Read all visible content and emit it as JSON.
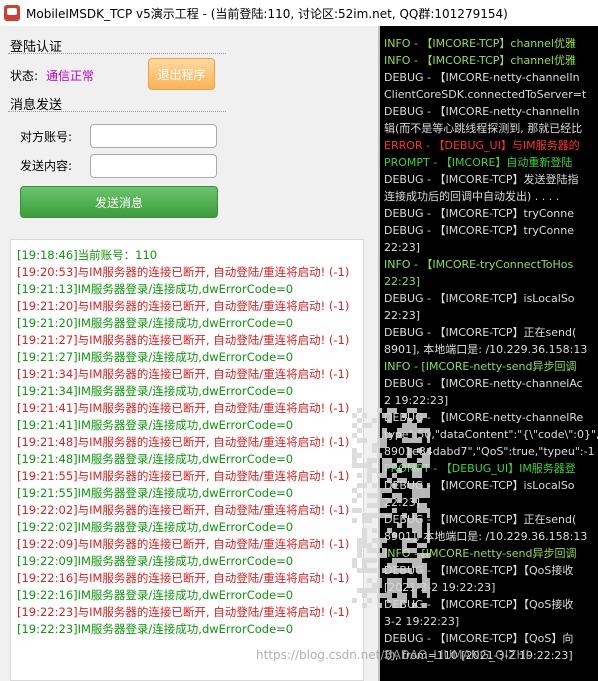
{
  "window": {
    "title": "MobileIMSDK_TCP v5演示工程 - (当前登陆:110, 讨论区:52im.net, QQ群:101279154)"
  },
  "login_section": {
    "title": "登陆认证",
    "status_label": "状态:",
    "status_value": "通信正常",
    "logout_button": "退出程序"
  },
  "message_section": {
    "title": "消息发送",
    "to_account_label": "对方账号:",
    "to_account_value": "",
    "content_label": "发送内容:",
    "content_value": "",
    "send_button": "发送消息"
  },
  "log": [
    {
      "text": "[19:18:46]当前账号：110",
      "level": "ok"
    },
    {
      "text": "[19:20:53]与IM服务器的连接已断开, 自动登陆/重连将启动! (-1)",
      "level": "error"
    },
    {
      "text": "[19:21:13]IM服务器登录/连接成功,dwErrorCode=0",
      "level": "ok"
    },
    {
      "text": "[19:21:20]与IM服务器的连接已断开, 自动登陆/重连将启动! (-1)",
      "level": "error"
    },
    {
      "text": "[19:21:20]IM服务器登录/连接成功,dwErrorCode=0",
      "level": "ok"
    },
    {
      "text": "[19:21:27]与IM服务器的连接已断开, 自动登陆/重连将启动! (-1)",
      "level": "error"
    },
    {
      "text": "[19:21:27]IM服务器登录/连接成功,dwErrorCode=0",
      "level": "ok"
    },
    {
      "text": "[19:21:34]与IM服务器的连接已断开, 自动登陆/重连将启动! (-1)",
      "level": "error"
    },
    {
      "text": "[19:21:34]IM服务器登录/连接成功,dwErrorCode=0",
      "level": "ok"
    },
    {
      "text": "[19:21:41]与IM服务器的连接已断开, 自动登陆/重连将启动! (-1)",
      "level": "error"
    },
    {
      "text": "[19:21:41]IM服务器登录/连接成功,dwErrorCode=0",
      "level": "ok"
    },
    {
      "text": "[19:21:48]与IM服务器的连接已断开, 自动登陆/重连将启动! (-1)",
      "level": "error"
    },
    {
      "text": "[19:21:48]IM服务器登录/连接成功,dwErrorCode=0",
      "level": "ok"
    },
    {
      "text": "[19:21:55]与IM服务器的连接已断开, 自动登陆/重连将启动! (-1)",
      "level": "error"
    },
    {
      "text": "[19:21:55]IM服务器登录/连接成功,dwErrorCode=0",
      "level": "ok"
    },
    {
      "text": "[19:22:02]与IM服务器的连接已断开, 自动登陆/重连将启动! (-1)",
      "level": "error"
    },
    {
      "text": "[19:22:02]IM服务器登录/连接成功,dwErrorCode=0",
      "level": "ok"
    },
    {
      "text": "[19:22:09]与IM服务器的连接已断开, 自动登陆/重连将启动! (-1)",
      "level": "error"
    },
    {
      "text": "[19:22:09]IM服务器登录/连接成功,dwErrorCode=0",
      "level": "ok"
    },
    {
      "text": "[19:22:16]与IM服务器的连接已断开, 自动登陆/重连将启动! (-1)",
      "level": "error"
    },
    {
      "text": "[19:22:16]IM服务器登录/连接成功,dwErrorCode=0",
      "level": "ok"
    },
    {
      "text": "[19:22:23]与IM服务器的连接已断开, 自动登陆/重连将启动! (-1)",
      "level": "error"
    },
    {
      "text": "[19:22:23]IM服务器登录/连接成功,dwErrorCode=0",
      "level": "ok"
    }
  ],
  "console": [
    {
      "text": "INFO - 【IMCORE-TCP】channel优雅",
      "kind": "info"
    },
    {
      "text": "INFO - 【IMCORE-TCP】channel优雅",
      "kind": "info"
    },
    {
      "text": "DEBUG - 【IMCORE-netty-channelIn",
      "kind": "debug"
    },
    {
      "text": "ClientCoreSDK.connectedToServer=t",
      "kind": "debug"
    },
    {
      "text": "DEBUG - 【IMCORE-netty-channelIn",
      "kind": "debug"
    },
    {
      "text": "辑(而不是等心跳线程探测到, 那就已经比",
      "kind": "debug"
    },
    {
      "text": "ERROR - 【DEBUG_UI】与IM服务器的",
      "kind": "error"
    },
    {
      "text": "PROMPT - 【IMCORE】自动重新登陆",
      "kind": "prompt"
    },
    {
      "text": "DEBUG - 【IMCORE-TCP】发送登陆指",
      "kind": "debug"
    },
    {
      "text": "连接成功后的回调中自动发出) . . . .",
      "kind": "debug"
    },
    {
      "text": "DEBUG - 【IMCORE-TCP】tryConne",
      "kind": "debug"
    },
    {
      "text": "DEBUG - 【IMCORE-TCP】tryConne",
      "kind": "debug"
    },
    {
      "text": "22:23]",
      "kind": "debug"
    },
    {
      "text": "INFO - 【IMCORE-tryConnectToHos",
      "kind": "info"
    },
    {
      "text": "22:23]",
      "kind": "info"
    },
    {
      "text": "DEBUG - 【IMCORE-TCP】isLocalSo",
      "kind": "debug"
    },
    {
      "text": "22:23]",
      "kind": "debug"
    },
    {
      "text": "DEBUG - 【IMCORE-TCP】正在send(",
      "kind": "debug"
    },
    {
      "text": "8901], 本地端口是: /10.229.36.158:13",
      "kind": "debug"
    },
    {
      "text": "INFO - [IMCORE-netty-send异步回调",
      "kind": "info"
    },
    {
      "text": "DEBUG - 【IMCORE-netty-channelAc",
      "kind": "debug"
    },
    {
      "text": "2 19:22:23]",
      "kind": "debug"
    },
    {
      "text": "DEBUG - 【IMCORE-netty-channelRe",
      "kind": "debug"
    },
    {
      "text": "type\":50,\"dataContent\":\"{\\\"code\\\":0}\",",
      "kind": "debug"
    },
    {
      "text": "8901e84dabd7\",\"QoS\":true,\"typeu\":-1",
      "kind": "debug"
    },
    {
      "text": "PROMPT - 【DEBUG_UI】IM服务器登",
      "kind": "prompt"
    },
    {
      "text": "DEBUG - 【IMCORE-TCP】isLocalSo",
      "kind": "debug"
    },
    {
      "text": "22:23]",
      "kind": "debug"
    },
    {
      "text": "DEBUG - 【IMCORE-TCP】正在send(",
      "kind": "debug"
    },
    {
      "text": "8901], 本地端口是: /10.229.36.158:13",
      "kind": "debug"
    },
    {
      "text": "INFO - [IMCORE-netty-send异步回调",
      "kind": "info"
    },
    {
      "text": "DEBUG - 【IMCORE-TCP】【QoS接收",
      "kind": "debug"
    },
    {
      "text": "[2021-3-2 19:22:23]",
      "kind": "debug"
    },
    {
      "text": "DEBUG - 【IMCORE-TCP】【QoS接收",
      "kind": "debug"
    },
    {
      "text": "3-2 19:22:23]",
      "kind": "debug"
    },
    {
      "text": "DEBUG - 【IMCORE-TCP】【QoS】向",
      "kind": "debug"
    },
    {
      "text": "功, from=110 [2021-3-2 19:22:23]",
      "kind": "debug"
    }
  ],
  "watermark": "https://blog.csdn.net/BADAO_LIUMANG_QIZHI",
  "colors": {
    "ok": "#0a9a0a",
    "error": "#e02020",
    "status": "#c000c0",
    "logout_button": "#f9b456",
    "send_button": "#3a9e3a"
  }
}
